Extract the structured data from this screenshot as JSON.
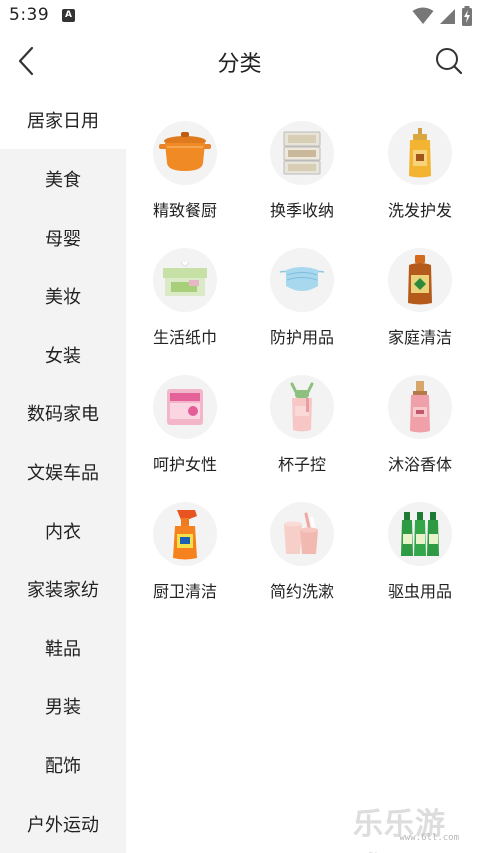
{
  "status_bar": {
    "time": "5:39",
    "notification_icon": "font-a-icon",
    "icons": [
      "wifi-icon",
      "signal-icon",
      "battery-charging-icon"
    ]
  },
  "header": {
    "title": "分类",
    "back_icon": "back-chevron-icon",
    "search_icon": "search-icon"
  },
  "sidebar": {
    "active_index": 0,
    "items": [
      {
        "label": "居家日用"
      },
      {
        "label": "美食"
      },
      {
        "label": "母婴"
      },
      {
        "label": "美妆"
      },
      {
        "label": "女装"
      },
      {
        "label": "数码家电"
      },
      {
        "label": "文娱车品"
      },
      {
        "label": "内衣"
      },
      {
        "label": "家装家纺"
      },
      {
        "label": "鞋品"
      },
      {
        "label": "男装"
      },
      {
        "label": "配饰"
      },
      {
        "label": "户外运动"
      }
    ]
  },
  "categories": [
    {
      "label": "精致餐厨",
      "icon": "cookware-pot-icon"
    },
    {
      "label": "换季收纳",
      "icon": "storage-drawer-icon"
    },
    {
      "label": "洗发护发",
      "icon": "shampoo-bottle-icon"
    },
    {
      "label": "生活纸巾",
      "icon": "tissue-box-icon"
    },
    {
      "label": "防护用品",
      "icon": "face-mask-icon"
    },
    {
      "label": "家庭清洁",
      "icon": "disinfectant-bottle-icon"
    },
    {
      "label": "呵护女性",
      "icon": "sanitary-pad-icon"
    },
    {
      "label": "杯子控",
      "icon": "water-cup-icon"
    },
    {
      "label": "沐浴香体",
      "icon": "body-mist-icon"
    },
    {
      "label": "厨卫清洁",
      "icon": "spray-cleaner-icon"
    },
    {
      "label": "简约洗漱",
      "icon": "toothbrush-cup-icon"
    },
    {
      "label": "驱虫用品",
      "icon": "insect-repellent-icon"
    }
  ],
  "watermark": {
    "text": "乐乐游戏",
    "url": "www.6ll.com"
  },
  "colors": {
    "sidebar_bg": "#f3f3f3",
    "active_bg": "#ffffff",
    "text": "#222222",
    "image_bg": "#f3f3f3"
  }
}
